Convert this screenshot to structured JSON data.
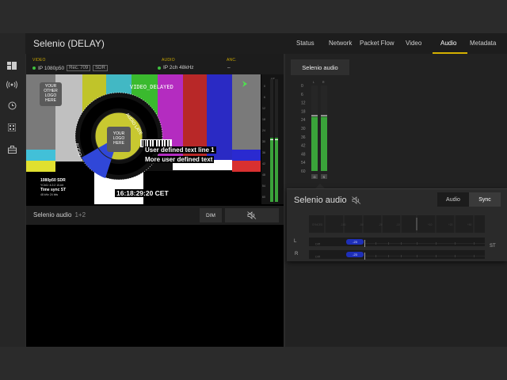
{
  "app": {
    "title": "Selenio (DELAY)"
  },
  "tabs": [
    {
      "label": "Status"
    },
    {
      "label": "Network"
    },
    {
      "label": "Packet Flow"
    },
    {
      "label": "Video"
    },
    {
      "label": "Audio",
      "active": true
    },
    {
      "label": "Metadata"
    }
  ],
  "signal": {
    "video_head": "VIDEO",
    "video_format": "IP 1080p50",
    "video_colorimetry": "Rec. 709",
    "video_range": "SDR",
    "audio_head": "AUDIO",
    "audio_format": "IP 2ch 48kHz",
    "anc_head": "ANC.",
    "anc_value": "–"
  },
  "video_overlay": {
    "logo_topleft": "YOUR\nOTHER\nLOGO\nHERE",
    "logo_center": "YOUR\nLOGO\nHERE",
    "ring_top": "VIDEO_DELAYED",
    "ring_right": "AUDIO LATE",
    "ring_left": "AUDIO",
    "text_line_1": "User defined text line 1",
    "text_line_2": "More user defined text",
    "format_info": "1080p50 SDR",
    "format_sub": "YCbCr 4:2:2 10-bit",
    "time_sync": "Time sync ST",
    "time_sync_sub": "48 kHz 24 bits",
    "clock": "16:18:29:20 CET"
  },
  "audio_strip": {
    "name": "Selenio audio",
    "channels": "1+2",
    "dim_label": "DIM"
  },
  "right_panel": {
    "selector_label": "Selenio audio",
    "meter_scale": [
      "0",
      "6",
      "12",
      "18",
      "24",
      "30",
      "36",
      "42",
      "48",
      "54",
      "60"
    ],
    "meter_levels_db": [
      -22,
      -22
    ],
    "meter_channels": [
      "G",
      "S"
    ],
    "meter_headers": [
      "L",
      "R"
    ]
  },
  "popup": {
    "title": "Selenio audio",
    "seg_audio": "Audio",
    "seg_sync": "Sync",
    "row_left_label": "L",
    "row_right_label": "R",
    "st_label": "ST",
    "left_value": "-23",
    "right_value": "-23"
  },
  "colors": {
    "accent": "#d4b000",
    "meter_green": "#3aa33a",
    "sync_pill": "#1e2fb8"
  }
}
